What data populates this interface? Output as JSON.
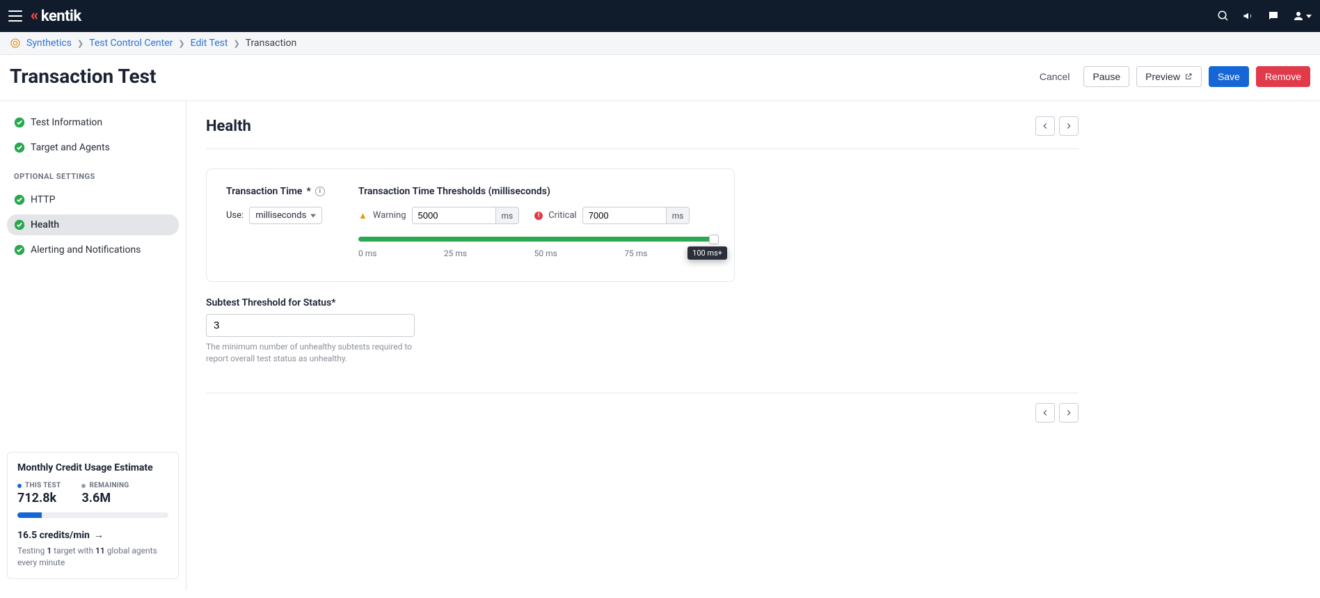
{
  "brand": "kentik",
  "breadcrumb": {
    "root": "Synthetics",
    "control": "Test Control Center",
    "edit": "Edit Test",
    "current": "Transaction"
  },
  "page": {
    "title": "Transaction Test",
    "cancel": "Cancel",
    "pause": "Pause",
    "preview": "Preview",
    "save": "Save",
    "remove": "Remove"
  },
  "sidebar": {
    "items": [
      {
        "label": "Test Information"
      },
      {
        "label": "Target and Agents"
      }
    ],
    "section": "OPTIONAL SETTINGS",
    "optional": [
      {
        "label": "HTTP"
      },
      {
        "label": "Health"
      },
      {
        "label": "Alerting and Notifications"
      }
    ]
  },
  "credits": {
    "title": "Monthly Credit Usage Estimate",
    "thisLabel": "THIS TEST",
    "thisValue": "712.8k",
    "remainLabel": "REMAINING",
    "remainValue": "3.6M",
    "rate": "16.5 credits/min",
    "desc_pre": "Testing ",
    "target_n": "1",
    "desc_mid": " target with ",
    "agents_n": "11",
    "desc_post": " global agents every minute"
  },
  "main": {
    "section": "Health",
    "txTimeLabel": "Transaction Time",
    "useLabel": "Use:",
    "useValue": "milliseconds",
    "threshTitle": "Transaction Time Thresholds (milliseconds)",
    "warningLabel": "Warning",
    "warningValue": "5000",
    "criticalLabel": "Critical",
    "criticalValue": "7000",
    "unit": "ms",
    "ticks": [
      "0 ms",
      "25 ms",
      "50 ms",
      "75 ms",
      ""
    ],
    "tooltip": "100 ms+",
    "subtestLabel": "Subtest Threshold for Status",
    "subtestValue": "3",
    "subtestHelp": "The minimum number of unhealthy subtests required to report overall test status as unhealthy."
  }
}
